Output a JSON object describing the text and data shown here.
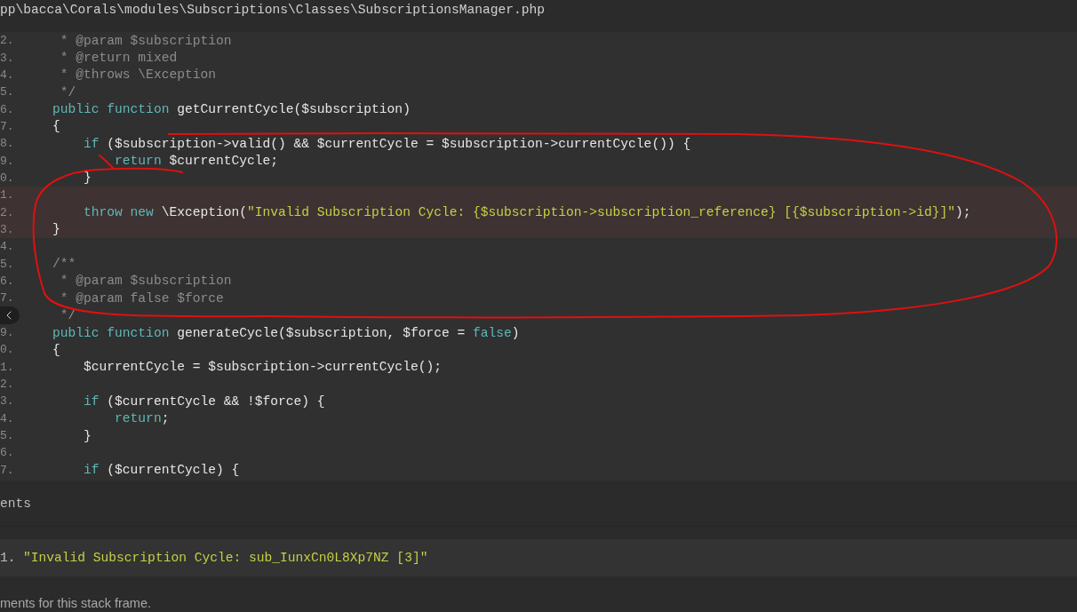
{
  "file_path": "pp\\bacca\\Corals\\modules\\Subscriptions\\Classes\\SubscriptionsManager.php",
  "code_lines": [
    {
      "number": "2.",
      "highlighted": false,
      "tokens": [
        {
          "kind": "comment",
          "text": "     * @param $subscription"
        }
      ]
    },
    {
      "number": "3.",
      "highlighted": false,
      "tokens": [
        {
          "kind": "comment",
          "text": "     * @return mixed"
        }
      ]
    },
    {
      "number": "4.",
      "highlighted": false,
      "tokens": [
        {
          "kind": "comment",
          "text": "     * @throws \\Exception"
        }
      ]
    },
    {
      "number": "5.",
      "highlighted": false,
      "tokens": [
        {
          "kind": "comment",
          "text": "     */"
        }
      ]
    },
    {
      "number": "6.",
      "highlighted": false,
      "tokens": [
        {
          "kind": "keyword",
          "text": "    public function "
        },
        {
          "kind": "plain",
          "text": "getCurrentCycle($subscription)"
        }
      ]
    },
    {
      "number": "7.",
      "highlighted": false,
      "tokens": [
        {
          "kind": "plain",
          "text": "    {"
        }
      ]
    },
    {
      "number": "8.",
      "highlighted": false,
      "tokens": [
        {
          "kind": "keyword",
          "text": "        if "
        },
        {
          "kind": "plain",
          "text": "($subscription->valid() && $currentCycle = $subscription->currentCycle()) {"
        }
      ]
    },
    {
      "number": "9.",
      "highlighted": false,
      "tokens": [
        {
          "kind": "keyword",
          "text": "            return "
        },
        {
          "kind": "plain",
          "text": "$currentCycle;"
        }
      ]
    },
    {
      "number": "0.",
      "highlighted": false,
      "tokens": [
        {
          "kind": "plain",
          "text": "        }"
        }
      ]
    },
    {
      "number": "1.",
      "highlighted": true
    },
    {
      "number": "2.",
      "highlighted": true,
      "tokens": [
        {
          "kind": "keyword",
          "text": "        throw new "
        },
        {
          "kind": "plain",
          "text": "\\Exception("
        },
        {
          "kind": "string",
          "text": "\"Invalid Subscription Cycle: {$subscription->subscription_reference} [{$subscription->id}]\""
        },
        {
          "kind": "plain",
          "text": ");"
        }
      ]
    },
    {
      "number": "3.",
      "highlighted": true,
      "tokens": [
        {
          "kind": "plain",
          "text": "    }"
        }
      ]
    },
    {
      "number": "4.",
      "highlighted": false
    },
    {
      "number": "5.",
      "highlighted": false,
      "tokens": [
        {
          "kind": "comment",
          "text": "    /**"
        }
      ]
    },
    {
      "number": "6.",
      "highlighted": false,
      "tokens": [
        {
          "kind": "comment",
          "text": "     * @param $subscription"
        }
      ]
    },
    {
      "number": "7.",
      "highlighted": false,
      "tokens": [
        {
          "kind": "comment",
          "text": "     * @param false $force"
        }
      ]
    },
    {
      "highlighted": false,
      "tokens": [
        {
          "kind": "comment",
          "text": "     */"
        }
      ]
    },
    {
      "number": "9.",
      "highlighted": false,
      "tokens": [
        {
          "kind": "keyword",
          "text": "    public function "
        },
        {
          "kind": "plain",
          "text": "generateCycle($subscription, $force = "
        },
        {
          "kind": "keyword",
          "text": "false"
        },
        {
          "kind": "plain",
          "text": ")"
        }
      ]
    },
    {
      "number": "0.",
      "highlighted": false,
      "tokens": [
        {
          "kind": "plain",
          "text": "    {"
        }
      ]
    },
    {
      "number": "1.",
      "highlighted": false,
      "tokens": [
        {
          "kind": "plain",
          "text": "        $currentCycle = $subscription->currentCycle();"
        }
      ]
    },
    {
      "number": "2.",
      "highlighted": false
    },
    {
      "number": "3.",
      "highlighted": false,
      "tokens": [
        {
          "kind": "keyword",
          "text": "        if "
        },
        {
          "kind": "plain",
          "text": "($currentCycle && !$force) {"
        }
      ]
    },
    {
      "number": "4.",
      "highlighted": false,
      "tokens": [
        {
          "kind": "keyword",
          "text": "            return"
        },
        {
          "kind": "plain",
          "text": ";"
        }
      ]
    },
    {
      "number": "5.",
      "highlighted": false,
      "tokens": [
        {
          "kind": "plain",
          "text": "        }"
        }
      ]
    },
    {
      "number": "6.",
      "highlighted": false
    },
    {
      "number": "7.",
      "highlighted": false,
      "tokens": [
        {
          "kind": "keyword",
          "text": "        if "
        },
        {
          "kind": "plain",
          "text": "($currentCycle) {"
        }
      ]
    }
  ],
  "arguments": {
    "title": "ents",
    "items": [
      {
        "number": "1.",
        "value": "\"Invalid Subscription Cycle: sub_IunxCn0L8Xp7NZ [3]\""
      }
    ],
    "note": "ments for this stack frame."
  }
}
